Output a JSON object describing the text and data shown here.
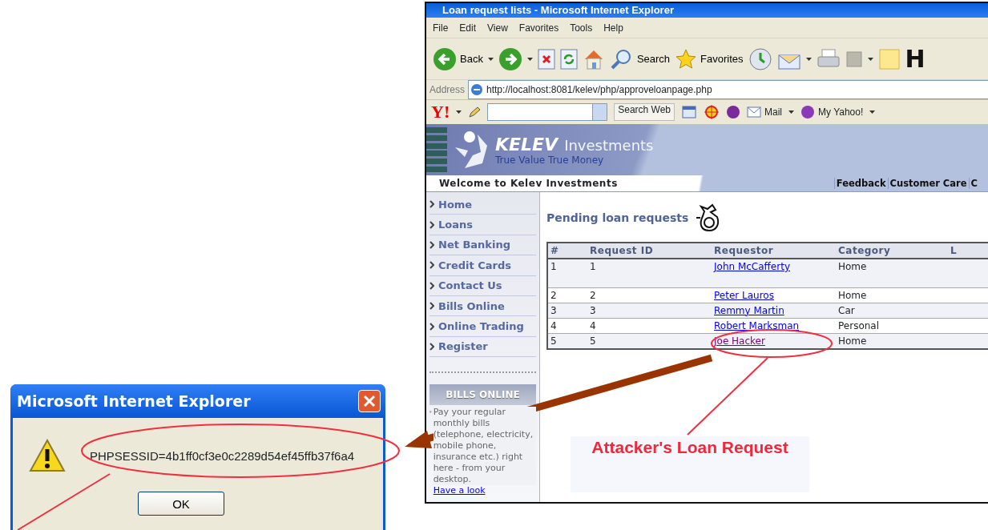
{
  "browser": {
    "title": "Loan request lists - Microsoft Internet Explorer",
    "menu": [
      "File",
      "Edit",
      "View",
      "Favorites",
      "Tools",
      "Help"
    ],
    "toolbar": [
      {
        "kind": "back",
        "label": "Back"
      },
      {
        "kind": "forward"
      },
      {
        "kind": "stop"
      },
      {
        "kind": "refresh"
      },
      {
        "kind": "home"
      },
      {
        "kind": "search",
        "label": "Search"
      },
      {
        "kind": "favorites",
        "label": "Favorites"
      },
      {
        "kind": "history"
      },
      {
        "kind": "mail"
      },
      {
        "kind": "print"
      },
      {
        "kind": "edit"
      },
      {
        "kind": "note"
      },
      {
        "kind": "letter",
        "label": "H"
      }
    ],
    "address": {
      "label": "Address",
      "url": "http://localhost:8081/kelev/php/approveloanpage.php"
    },
    "yahoo_bar": {
      "logo": "Y!",
      "search_button": "Search Web",
      "items": [
        "Mail",
        "My Yahoo!"
      ]
    }
  },
  "site": {
    "brand": "KELEV",
    "brand_suffix": "Investments",
    "tagline": "True Value True Money",
    "welcome": "Welcome to Kelev Investments",
    "top_links": [
      "Feedback",
      "Customer Care",
      "C"
    ],
    "nav": [
      "Home",
      "Loans",
      "Net Banking",
      "Credit Cards",
      "Contact Us",
      "Bills Online",
      "Online Trading",
      "Register"
    ],
    "promo": {
      "title": "BILLS ONLINE",
      "text": "Pay your regular monthly bills (telephone, electricity, mobile phone, insurance etc.) right here - from your desktop.",
      "link": "Have a look"
    },
    "heading": "Pending loan requests",
    "table": {
      "columns": [
        "#",
        "Request ID",
        "Requestor",
        "Category",
        "L"
      ],
      "rows": [
        {
          "cells": [
            "1",
            "1",
            "John McCafferty",
            "Home"
          ],
          "visited": false
        },
        {
          "cells": [
            "2",
            "2",
            "Peter Lauros",
            "Home"
          ],
          "visited": false
        },
        {
          "cells": [
            "3",
            "3",
            "Remmy Martin",
            "Car"
          ],
          "visited": false
        },
        {
          "cells": [
            "4",
            "4",
            "Robert Marksman",
            "Personal"
          ],
          "visited": false
        },
        {
          "cells": [
            "5",
            "5",
            "Joe Hacker",
            "Home"
          ],
          "visited": true
        }
      ]
    }
  },
  "dialog": {
    "title": "Microsoft Internet Explorer",
    "message": "PHPSESSID=4b1ff0cf3e0c2289d54ef45ffb37f6a4",
    "button": "OK"
  },
  "annotation": {
    "label": "Attacker's Loan Request"
  }
}
